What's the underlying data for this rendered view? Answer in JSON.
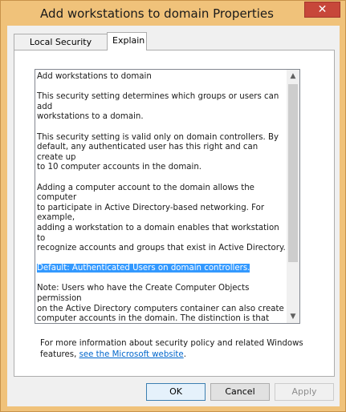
{
  "window": {
    "title": "Add workstations to domain Properties",
    "close_glyph": "✕"
  },
  "tabs": [
    {
      "label": "Local Security Setting"
    },
    {
      "label": "Explain",
      "selected": true
    }
  ],
  "explain": {
    "paragraphs": [
      "Add workstations to domain",
      "This security setting determines which groups or users can add\nworkstations to a domain.",
      "This security setting is valid only on domain controllers. By\ndefault, any authenticated user has this right and can create up\nto 10 computer accounts in the domain.",
      "Adding a computer account to the domain allows the computer\nto participate in Active Directory-based networking. For example,\nadding a workstation to a domain enables that workstation to\nrecognize accounts and groups that exist in Active Directory.",
      "Default: Authenticated Users on domain controllers.",
      "Note: Users who have the Create Computer Objects permission\non the Active Directory computers container can also create\ncomputer accounts in the domain. The distinction is that users\nwith permissions on the container are not restricted to the\ncreation of only 10 computer accounts. In addition, computer\naccounts that are created by means of Add workstations to\ndomain have Domain Administrators as the owner of the\ncomputer account, while computer accounts that are created by"
    ],
    "scroll_up_glyph": "▲",
    "scroll_down_glyph": "▼"
  },
  "footer": {
    "text_before_link": "For more information about security policy and related Windows\nfeatures, ",
    "link": "see the Microsoft website",
    "text_after_link": "."
  },
  "buttons": {
    "ok": "OK",
    "cancel": "Cancel",
    "apply": "Apply"
  },
  "colors": {
    "title_bar": "#f0c27a",
    "close_button": "#c7473a",
    "selection": "#3399ff",
    "link": "#0066cc"
  }
}
